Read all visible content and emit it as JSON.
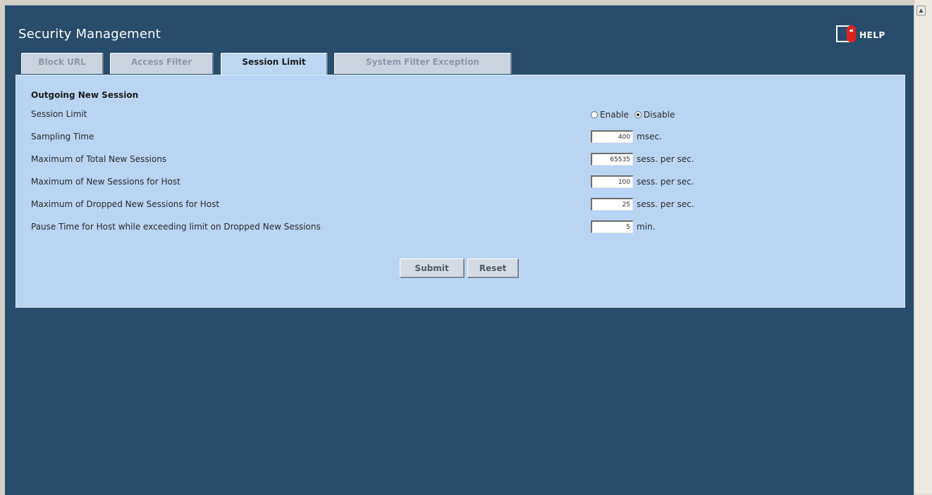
{
  "page": {
    "title": "Security Management",
    "help_label": "HELP"
  },
  "tabs": [
    {
      "label": "Block URL",
      "active": false
    },
    {
      "label": "Access Filter",
      "active": false
    },
    {
      "label": "Session Limit",
      "active": true
    },
    {
      "label": "System Filter Exception",
      "active": false
    }
  ],
  "form": {
    "section_title": "Outgoing New Session",
    "session_limit": {
      "label": "Session Limit",
      "enable_label": "Enable",
      "disable_label": "Disable",
      "selected": "Disable"
    },
    "sampling_time": {
      "label": "Sampling Time",
      "value": "400",
      "unit": "msec."
    },
    "max_total_new_sessions": {
      "label": "Maximum of Total New Sessions",
      "value": "65535",
      "unit": "sess. per sec."
    },
    "max_new_sessions_host": {
      "label": "Maximum of New Sessions for Host",
      "value": "100",
      "unit": "sess. per sec."
    },
    "max_dropped_new_sessions_host": {
      "label": "Maximum of Dropped New Sessions for Host",
      "value": "25",
      "unit": "sess. per sec."
    },
    "pause_time": {
      "label": "Pause Time for Host while exceeding limit on Dropped New Sessions",
      "value": "5",
      "unit": "min."
    }
  },
  "buttons": {
    "submit": "Submit",
    "reset": "Reset"
  },
  "colors": {
    "frame": "#284c6c",
    "panel": "#bad5f4",
    "active_tab": "#bcd6f4",
    "help_accent": "#e0201a"
  }
}
